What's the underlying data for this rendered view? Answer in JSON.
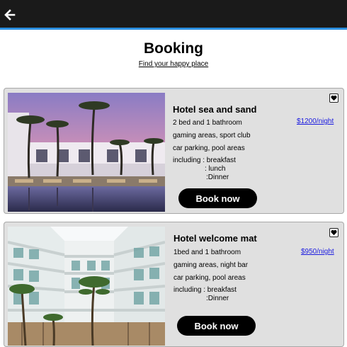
{
  "header": {
    "back_icon": "arrow-left-icon"
  },
  "page": {
    "title": "Booking",
    "subtitle": "Find your happy place"
  },
  "hotels": [
    {
      "name": "Hotel sea and sand",
      "rooms": "2 bed and 1 bathroom",
      "amenities_1": "gaming areas, sport club",
      "amenities_2": "car parking, pool areas",
      "including_label": "including : breakfast",
      "including_extra_1": ": lunch",
      "including_extra_2": ":Dinner",
      "price": "$1200/night",
      "book_label": "Book now",
      "fav_icon": "heart-icon"
    },
    {
      "name": "Hotel welcome mat",
      "rooms": "1bed and 1 bathroom",
      "amenities_1": "gaming areas, night bar",
      "amenities_2": "car parking, pool areas",
      "including_label": "including : breakfast",
      "including_extra_1": ":Dinner",
      "price": "$950/night",
      "book_label": "Book now",
      "fav_icon": "heart-icon"
    }
  ],
  "colors": {
    "topbar": "#1a1a1a",
    "accent_line": "#2b8fe0",
    "card_bg": "#e0e0e0",
    "price_link": "#1a1ae0",
    "button_bg": "#000000"
  }
}
